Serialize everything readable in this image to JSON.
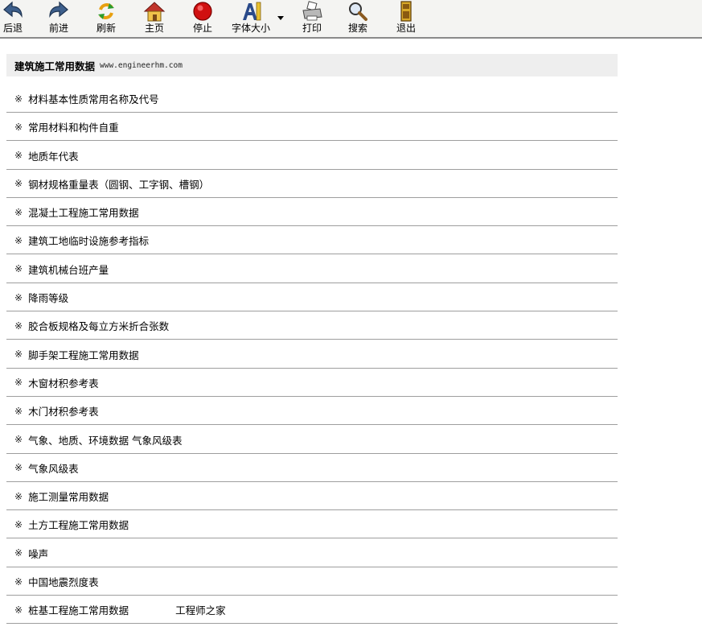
{
  "toolbar": {
    "back": "后退",
    "forward": "前进",
    "refresh": "刷新",
    "home": "主页",
    "stop": "停止",
    "font_size": "字体大小",
    "print": "打印",
    "search": "搜索",
    "exit": "退出"
  },
  "header": {
    "title": "建筑施工常用数据",
    "url": "www.engineerhm.com"
  },
  "bullet": "※",
  "items": [
    "材料基本性质常用名称及代号",
    "常用材料和构件自重",
    "地质年代表",
    "钢材规格重量表（圆钢、工字钢、槽钢）",
    "混凝土工程施工常用数据",
    "建筑工地临时设施参考指标",
    "建筑机械台班产量",
    "降雨等级",
    "胶合板规格及每立方米折合张数",
    "脚手架工程施工常用数据",
    "木窗材积参考表",
    "木门材积参考表",
    "气象、地质、环境数据 气象风级表",
    "气象风级表",
    "施工测量常用数据",
    "土方工程施工常用数据",
    "噪声",
    "中国地震烈度表",
    "桩基工程施工常用数据"
  ],
  "last_item_extra": "工程师之家",
  "colors": {
    "toolbar_bg": "#f4f4f2",
    "header_bg": "#eeeeee",
    "divider": "#9e9e9e",
    "stop_red": "#d01010",
    "home_red": "#c0342a"
  }
}
